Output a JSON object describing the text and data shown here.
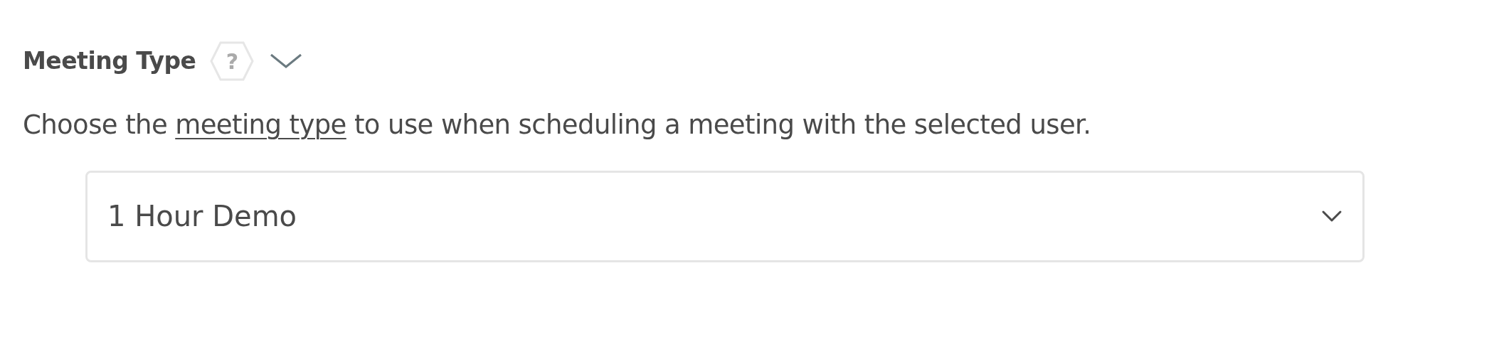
{
  "field": {
    "label": "Meeting Type",
    "help": "?",
    "collapsed": true,
    "description": [
      {
        "kind": "text",
        "text": "Choose the "
      },
      {
        "kind": "link",
        "text": "meeting type"
      },
      {
        "kind": "text",
        "text": " to use when scheduling a meeting with the selected user."
      }
    ],
    "select": {
      "value": "1 Hour Demo"
    }
  }
}
